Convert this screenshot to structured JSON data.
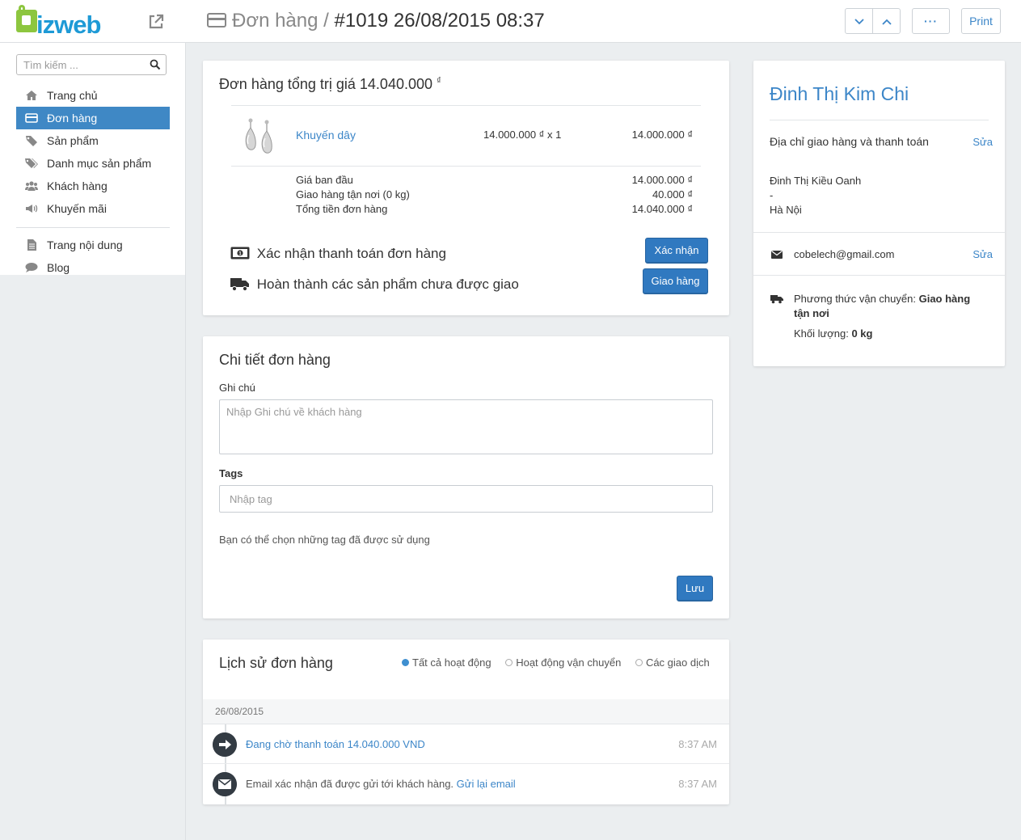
{
  "brand": {
    "logo_text": "bizweb"
  },
  "header": {
    "breadcrumb": "Đơn hàng",
    "separator": "/",
    "order_title": "#1019 26/08/2015 08:37",
    "prev_label": "⌄",
    "next_label": "⌃",
    "more_label": "···",
    "print_label": "Print"
  },
  "sidebar": {
    "search_placeholder": "Tìm kiếm ...",
    "items": [
      {
        "label": "Trang chủ",
        "icon": "home-icon"
      },
      {
        "label": "Đơn hàng",
        "icon": "card-icon",
        "active": true
      },
      {
        "label": "Sản phẩm",
        "icon": "tag-icon"
      },
      {
        "label": "Danh mục sản phẩm",
        "icon": "tags-icon"
      },
      {
        "label": "Khách hàng",
        "icon": "users-icon"
      },
      {
        "label": "Khuyến mãi",
        "icon": "megaphone-icon"
      }
    ],
    "items2": [
      {
        "label": "Trang nội dung",
        "icon": "document-icon"
      },
      {
        "label": "Blog",
        "icon": "comment-icon"
      }
    ]
  },
  "summary": {
    "heading": "Đơn hàng tổng trị giá 14.040.000",
    "currency": "₫",
    "product": {
      "name": "Khuyến dây",
      "price_qty": "14.000.000 ₫ x 1",
      "total": "14.000.000 ₫"
    },
    "lines": [
      {
        "label": "Giá ban đầu",
        "value": "14.000.000 ₫"
      },
      {
        "label": "Giao hàng tận nơi (0 kg)",
        "value": "40.000 ₫"
      },
      {
        "label": "Tổng tiền đơn hàng",
        "value": "14.040.000 ₫"
      }
    ],
    "confirm_text": "Xác nhận thanh toán đơn hàng",
    "confirm_button": "Xác nhận",
    "ship_text": "Hoàn thành các sản phẩm chưa được giao",
    "ship_button": "Giao hàng"
  },
  "detail": {
    "heading": "Chi tiết đơn hàng",
    "note_label": "Ghi chú",
    "note_placeholder": "Nhập Ghi chú về khách hàng",
    "tags_label": "Tags",
    "tags_placeholder": "Nhập tag",
    "tags_hint": "Bạn có thể chọn những tag đã được sử dụng",
    "save_button": "Lưu"
  },
  "history": {
    "heading": "Lịch sử đơn hàng",
    "filters": [
      {
        "label": "Tất cả hoạt động",
        "checked": true
      },
      {
        "label": "Hoạt động vận chuyển",
        "checked": false
      },
      {
        "label": "Các giao dịch",
        "checked": false
      }
    ],
    "date": "26/08/2015",
    "events": [
      {
        "text": "",
        "link": "Đang chờ thanh toán 14.040.000 VND",
        "time": "8:37 AM",
        "icon": "arrow-right-icon"
      },
      {
        "text": "Email xác nhận đã được gửi tới khách hàng. ",
        "link": "Gửi lại email",
        "time": "8:37 AM",
        "icon": "envelope-icon"
      }
    ]
  },
  "customer": {
    "name": "Đinh Thị Kim Chi",
    "address_heading": "Địa chỉ giao hàng và thanh toán",
    "edit_label": "Sửa",
    "address_lines": [
      "Đinh Thị Kiều Oanh",
      "-",
      "Hà Nội"
    ],
    "email": "cobelech@gmail.com",
    "shipping_method_label": "Phương thức vận chuyển:",
    "shipping_method": "Giao hàng tận nơi",
    "weight_label": "Khối lượng:",
    "weight": "0 kg"
  },
  "colors": {
    "accent": "#3079c0",
    "link": "#3c86c8",
    "brand_green": "#8dc63f",
    "brand_blue": "#1e9ad6"
  }
}
